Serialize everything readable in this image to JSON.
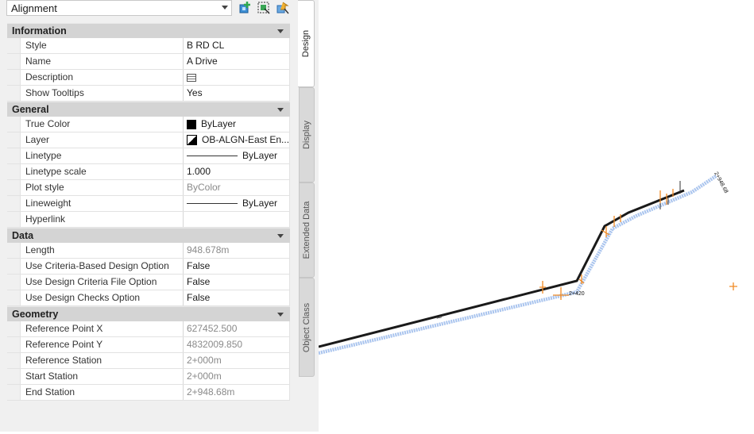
{
  "toolbar": {
    "object_type": "Alignment",
    "icons": [
      "quick-select-icon",
      "select-objects-icon",
      "toggle-pickadd-icon"
    ]
  },
  "categories": [
    {
      "title": "Information",
      "rows": [
        {
          "name": "Style",
          "value": "B RD CL"
        },
        {
          "name": "Name",
          "value": "A  Drive"
        },
        {
          "name": "Description",
          "value": ""
        },
        {
          "name": "Show Tooltips",
          "value": "Yes"
        }
      ]
    },
    {
      "title": "General",
      "rows": [
        {
          "name": "True Color",
          "value": "ByLayer"
        },
        {
          "name": "Layer",
          "value": "OB-ALGN-East  En..."
        },
        {
          "name": "Linetype",
          "value": "ByLayer"
        },
        {
          "name": "Linetype scale",
          "value": "1.000"
        },
        {
          "name": "Plot style",
          "value": "ByColor"
        },
        {
          "name": "Lineweight",
          "value": "ByLayer"
        },
        {
          "name": "Hyperlink",
          "value": ""
        }
      ]
    },
    {
      "title": "Data",
      "rows": [
        {
          "name": "Length",
          "value": "948.678m"
        },
        {
          "name": "Use Criteria-Based Design Option",
          "value": "False"
        },
        {
          "name": "Use Design Criteria File Option",
          "value": "False"
        },
        {
          "name": "Use Design Checks Option",
          "value": "False"
        }
      ]
    },
    {
      "title": "Geometry",
      "rows": [
        {
          "name": "Reference Point X",
          "value": "627452.500"
        },
        {
          "name": "Reference Point Y",
          "value": "4832009.850"
        },
        {
          "name": "Reference Station",
          "value": "2+000m"
        },
        {
          "name": "Start Station",
          "value": "2+000m"
        },
        {
          "name": "End Station",
          "value": "2+948.68m"
        }
      ]
    }
  ],
  "tabs": [
    "Design",
    "Display",
    "Extended Data",
    "Object Class"
  ],
  "drawing": {
    "alignment_color": "#1a1a1a",
    "offset_color": "#a9c4ee",
    "marker_color": "#f08a24",
    "labels": [
      "2+948.68",
      "2+420"
    ]
  }
}
